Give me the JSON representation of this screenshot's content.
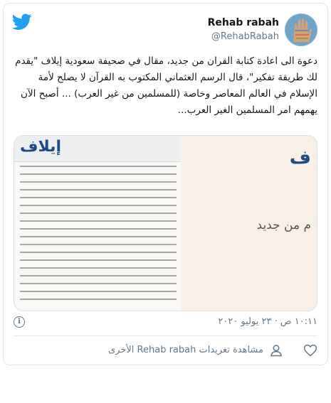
{
  "user": {
    "name": "Rehab rabah",
    "handle": "@RehabRabah"
  },
  "tweet": {
    "text": "دعوة الى اعادة كتابة القران من جديد، مقال في صحيفة سعودية إيلاف \"يقدم لك طريقة تفكير\"، قال الرسم العثماني المكتوب به القرآن لا يصلح لأمة الإسلام في العالم المعاصر وخاصة (للمسلمين من غير العرب) ... أصبح الآن يهمهم امر المسلمين الغير العرب..."
  },
  "media": {
    "clip_logo": "إيلاف",
    "right_letter": "ف",
    "right_text": "م من جديد"
  },
  "meta": {
    "timestamp": "١٠:١١ ص · ٢٣ يوليو ٢٠٢٠"
  },
  "actions": {
    "view_more": "مشاهدة تغريدات Rehab rabah الأخرى"
  },
  "icons": {
    "logo": "twitter-bird-icon",
    "info": "info-icon",
    "heart": "heart-icon",
    "person": "person-icon"
  },
  "colors": {
    "brand": "#1da1f2",
    "secondary_text": "#657786",
    "clip_logo": "#1f4b82"
  }
}
